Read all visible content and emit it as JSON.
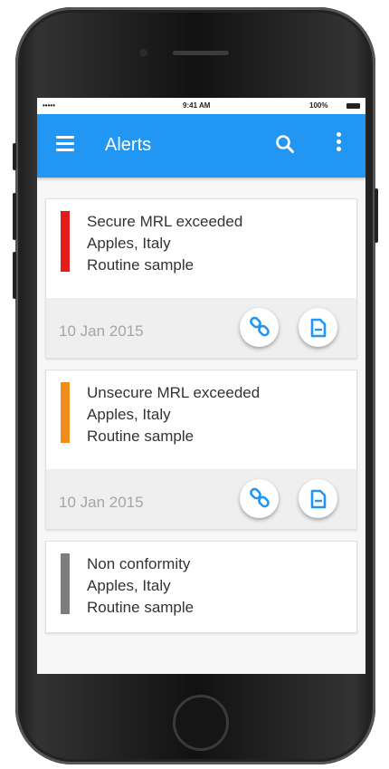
{
  "status_bar": {
    "carrier": "••••• ",
    "time": "9:41 AM",
    "battery": "100%"
  },
  "appbar": {
    "title": "Alerts",
    "icons": [
      "menu-icon",
      "search-icon",
      "overflow-menu-icon"
    ],
    "color": "#2196f3"
  },
  "alerts": [
    {
      "title": "Secure MRL exceeded",
      "product": "Apples, Italy",
      "sample": "Routine sample",
      "date": "10 Jan 2015",
      "color": "#e31b1b",
      "actions": [
        "link-icon",
        "document-icon"
      ]
    },
    {
      "title": "Unsecure MRL exceeded",
      "product": "Apples, Italy",
      "sample": "Routine sample",
      "date": "10 Jan 2015",
      "color": "#f28c1c",
      "actions": [
        "link-icon",
        "document-icon"
      ]
    },
    {
      "title": "Non conformity",
      "product": "Apples, Italy",
      "sample": "Routine sample",
      "color": "#7d7d7d"
    }
  ]
}
